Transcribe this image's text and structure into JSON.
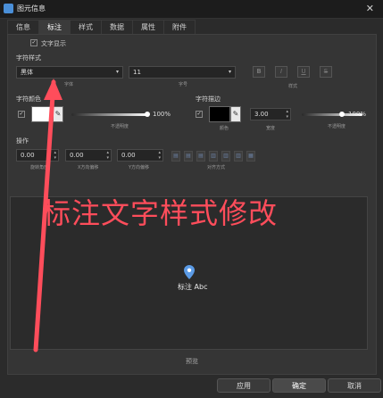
{
  "window": {
    "title": "图元信息",
    "close_glyph": "✕"
  },
  "tabs": [
    {
      "label": "信息"
    },
    {
      "label": "标注"
    },
    {
      "label": "样式"
    },
    {
      "label": "数据"
    },
    {
      "label": "属性"
    },
    {
      "label": "附件"
    }
  ],
  "active_tab": "标注",
  "text_display": {
    "label": "文字显示",
    "checked": true
  },
  "font_style": {
    "section_label": "字符样式",
    "font_value": "黑体",
    "font_caption": "字体",
    "size_value": "11",
    "size_caption": "字号",
    "style_buttons": [
      "B",
      "I",
      "U",
      "S"
    ],
    "style_caption": "样式"
  },
  "font_color": {
    "section_label": "字符颜色",
    "swatch_color": "#ffffff",
    "opacity_value": "100%",
    "opacity_caption": "不透明度"
  },
  "font_outline": {
    "section_label": "字符描边",
    "swatch_color": "#000000",
    "color_caption": "颜色",
    "width_value": "3.00",
    "width_caption": "宽度",
    "opacity_value": "100%",
    "opacity_caption": "不透明度"
  },
  "operation": {
    "section_label": "操作",
    "rotate_value": "0.00",
    "rotate_caption": "旋转角度",
    "x_offset_value": "0.00",
    "x_offset_caption": "X方向偏移",
    "y_offset_value": "0.00",
    "y_offset_caption": "Y方向偏移",
    "align_caption": "对齐方式"
  },
  "preview": {
    "label": "预览",
    "sample_text": "标注 Abc"
  },
  "annotation_overlay": "标注文字样式修改",
  "buttons": {
    "apply": "应用",
    "ok": "确定",
    "cancel": "取消"
  },
  "colors": {
    "accent": "#ff4d5b",
    "pin": "#5b9be6"
  }
}
